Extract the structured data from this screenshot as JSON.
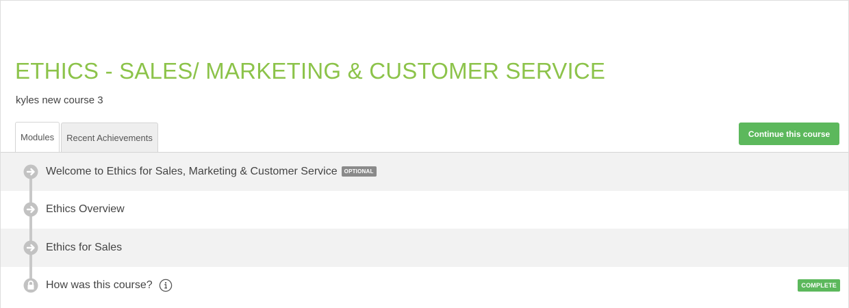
{
  "course": {
    "title": "ETHICS - SALES/ MARKETING & CUSTOMER SERVICE",
    "subtitle": "kyles new course 3"
  },
  "tabs": [
    {
      "label": "Modules",
      "active": true
    },
    {
      "label": "Recent Achievements",
      "active": false
    }
  ],
  "actions": {
    "continue_label": "Continue this course"
  },
  "modules": [
    {
      "label": "Welcome to Ethics for Sales, Marketing & Customer Service",
      "badge": "OPTIONAL",
      "icon": "arrow-circle-icon"
    },
    {
      "label": "Ethics Overview",
      "icon": "arrow-circle-icon"
    },
    {
      "label": "Ethics for Sales",
      "icon": "arrow-circle-icon"
    },
    {
      "label": "How was this course?",
      "icon": "lock-icon",
      "status": "COMPLETE"
    }
  ],
  "colors": {
    "title": "#8cc34a",
    "button": "#5cb85c",
    "badge_optional": "#8a8a8a",
    "badge_complete": "#5cb85c"
  }
}
